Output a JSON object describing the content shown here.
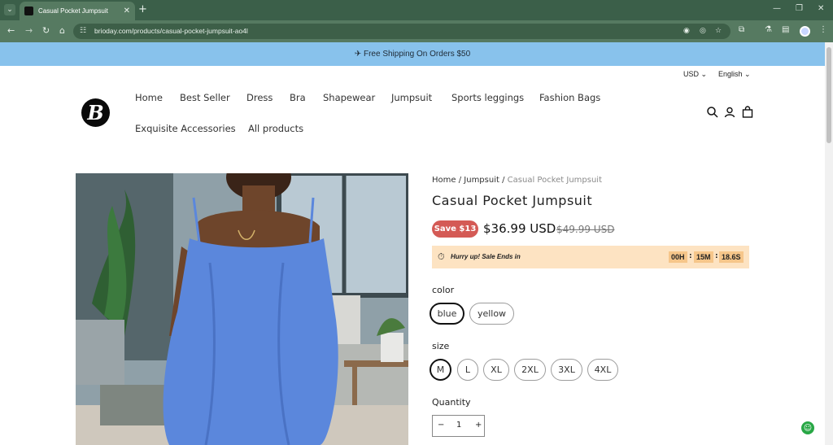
{
  "browser": {
    "tab_title": "Casual Pocket Jumpsuit",
    "url": "brioday.com/products/casual-pocket-jumpsuit-ao4l"
  },
  "announcement": "✈ Free Shipping On Orders $50",
  "locale": {
    "currency": "USD",
    "language": "English"
  },
  "logo": {
    "letter": "B"
  },
  "nav": {
    "row1": [
      "Home",
      "Best Seller",
      "Dress",
      "Bra",
      "Shapewear",
      "Jumpsuit",
      "Sports leggings",
      "Fashion Bags"
    ],
    "row2": [
      "Exquisite Accessories",
      "All products"
    ]
  },
  "breadcrumb": {
    "home": "Home",
    "sep": "/",
    "category": "Jumpsuit",
    "current": "Casual Pocket Jumpsuit"
  },
  "product": {
    "title": "Casual Pocket Jumpsuit",
    "save_badge": "Save $13",
    "price": "$36.99 USD",
    "compare_price": "$49.99 USD"
  },
  "timer": {
    "text": "Hurry up! Sale Ends in",
    "hours": "00H",
    "minutes": "15M",
    "seconds": "18.6S",
    "sep": ":"
  },
  "options": {
    "color_label": "color",
    "colors": [
      "blue",
      "yellow"
    ],
    "size_label": "size",
    "sizes": [
      "M",
      "L",
      "XL",
      "2XL",
      "3XL",
      "4XL"
    ]
  },
  "quantity": {
    "label": "Quantity",
    "value": "1",
    "minus": "−",
    "plus": "+"
  }
}
